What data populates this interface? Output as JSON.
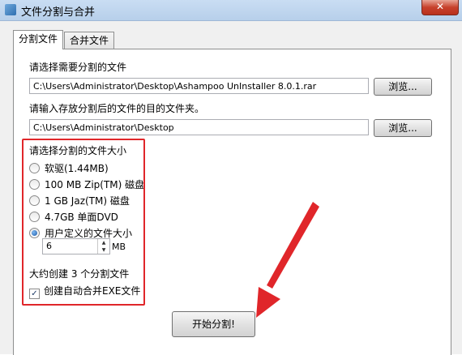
{
  "window": {
    "title": "文件分割与合并",
    "close_label": "✕"
  },
  "tabs": [
    {
      "label": "分割文件"
    },
    {
      "label": "合并文件"
    }
  ],
  "source": {
    "label": "请选择需要分割的文件",
    "value": "C:\\Users\\Administrator\\Desktop\\Ashampoo UnInstaller 8.0.1.rar",
    "browse_label": "浏览..."
  },
  "destination": {
    "label": "请输入存放分割后的文件的目的文件夹。",
    "value": "C:\\Users\\Administrator\\Desktop",
    "browse_label": "浏览..."
  },
  "size": {
    "label": "请选择分割的文件大小",
    "options": [
      {
        "label": "软驱(1.44MB)",
        "checked": false
      },
      {
        "label": "100 MB Zip(TM) 磁盘",
        "checked": false
      },
      {
        "label": "1 GB Jaz(TM) 磁盘",
        "checked": false
      },
      {
        "label": "4.7GB 单面DVD",
        "checked": false
      },
      {
        "label": "用户定义的文件大小",
        "checked": true
      }
    ],
    "custom_value": "6",
    "unit": "MB"
  },
  "estimate": "大约创建 3 个分割文件",
  "create_exe": {
    "label": "创建自动合并EXE文件",
    "checked": true
  },
  "start_label": "开始分割!",
  "colors": {
    "highlight": "#e0262a"
  }
}
